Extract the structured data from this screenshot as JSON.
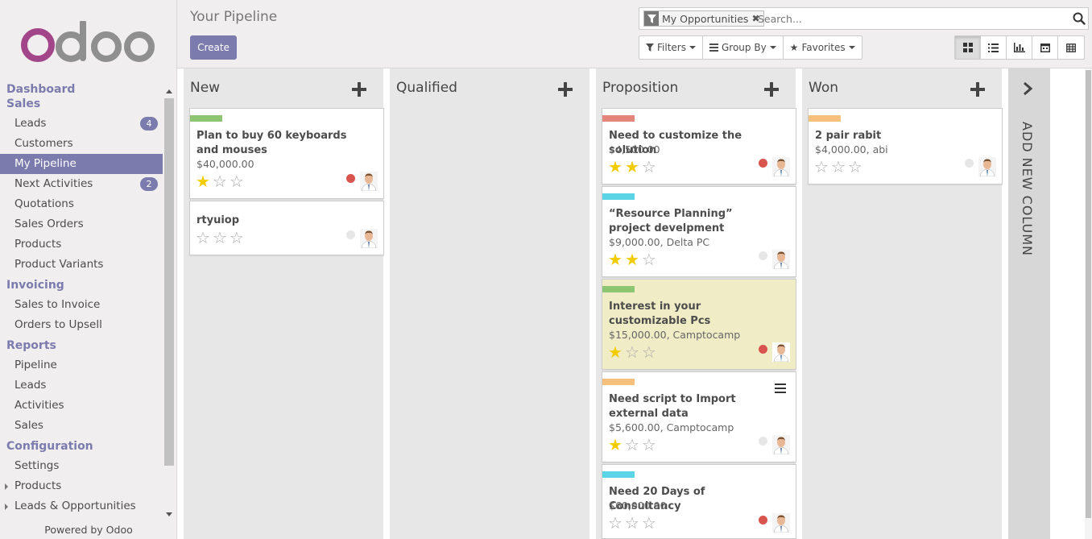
{
  "sidebar": {
    "sections": [
      {
        "title": "Dashboard",
        "items": []
      },
      {
        "title": "Sales",
        "items": [
          {
            "label": "Leads",
            "badge": "4"
          },
          {
            "label": "Customers"
          },
          {
            "label": "My Pipeline",
            "active": true
          },
          {
            "label": "Next Activities",
            "badge": "2"
          },
          {
            "label": "Quotations"
          },
          {
            "label": "Sales Orders"
          },
          {
            "label": "Products"
          },
          {
            "label": "Product Variants"
          }
        ]
      },
      {
        "title": "Invoicing",
        "items": [
          {
            "label": "Sales to Invoice"
          },
          {
            "label": "Orders to Upsell"
          }
        ]
      },
      {
        "title": "Reports",
        "items": [
          {
            "label": "Pipeline"
          },
          {
            "label": "Leads"
          },
          {
            "label": "Activities"
          },
          {
            "label": "Sales"
          }
        ]
      },
      {
        "title": "Configuration",
        "items": [
          {
            "label": "Settings"
          },
          {
            "label": "Products",
            "caret": true
          },
          {
            "label": "Leads & Opportunities",
            "caret": true
          }
        ]
      }
    ],
    "powered_by": "Powered by Odoo"
  },
  "control": {
    "title": "Your Pipeline",
    "create_label": "Create",
    "search": {
      "facet_label": "My Opportunities",
      "placeholder": "Search..."
    },
    "filters_label": "Filters",
    "groupby_label": "Group By",
    "favorites_label": "Favorites",
    "views": [
      "kanban",
      "list",
      "graph",
      "calendar",
      "pivot"
    ],
    "active_view": "kanban"
  },
  "kanban": {
    "columns": [
      {
        "name": "New",
        "cards": [
          {
            "title": "Plan to buy 60 keyboards and mouses",
            "sub": "$40,000.00",
            "stars": 1,
            "tag_color": "#8dc572",
            "dot": "red"
          },
          {
            "title": "rtyuiop",
            "sub": "",
            "stars": 0,
            "tag_color": "",
            "dot": "grey"
          }
        ]
      },
      {
        "name": "Qualified",
        "cards": []
      },
      {
        "name": "Proposition",
        "cards": [
          {
            "title": "Need to customize the solution",
            "sub": "$4,500.00",
            "stars": 2,
            "tag_color": "#e3857a",
            "dot": "red"
          },
          {
            "title": "“Resource Planning” project develpment",
            "sub": "$9,000.00, Delta PC",
            "stars": 2,
            "tag_color": "#5bd5e5",
            "dot": "grey"
          },
          {
            "title": "Interest in your customizable Pcs",
            "sub": "$15,000.00, Camptocamp",
            "stars": 1,
            "tag_color": "#8dc572",
            "dot": "red",
            "highlight": true
          },
          {
            "title": "Need script to Import external data",
            "sub": "$5,600.00, Camptocamp",
            "stars": 1,
            "tag_color": "#f7c07c",
            "dot": "grey",
            "menu": true
          },
          {
            "title": "Need 20 Days of Consultancy",
            "sub": "$60,000.00",
            "stars": 0,
            "tag_color": "#5bd5e5",
            "dot": "red"
          }
        ]
      },
      {
        "name": "Won",
        "cards": [
          {
            "title": "2 pair rabit",
            "sub": "$4,000.00, abi",
            "stars": 0,
            "tag_color": "#f7c07c",
            "dot": "grey"
          }
        ]
      }
    ],
    "add_column_label": "ADD NEW COLUMN"
  }
}
